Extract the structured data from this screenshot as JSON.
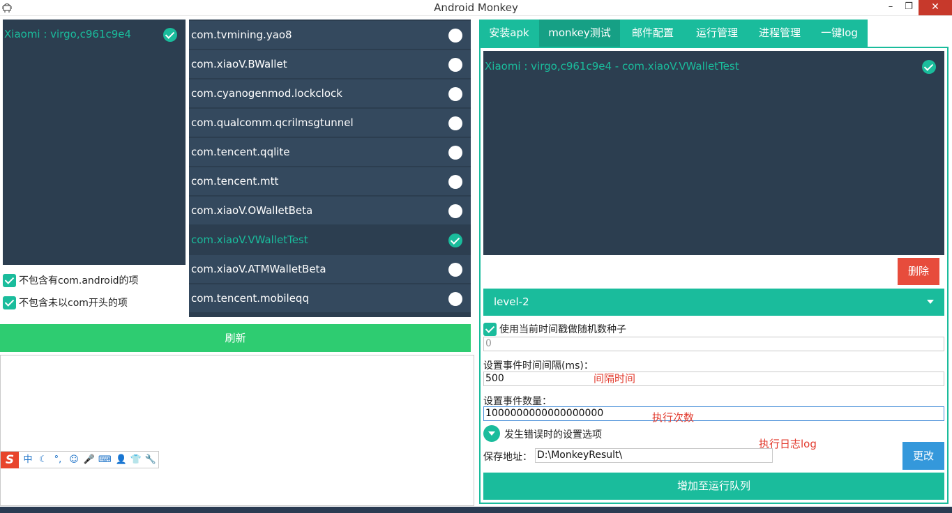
{
  "window": {
    "title": "Android Monkey",
    "minimize_glyph": "–",
    "maximize_glyph": "❐",
    "close_glyph": "✕"
  },
  "devices": {
    "items": [
      {
        "label": "Xiaomi : virgo,c961c9e4",
        "selected": true
      }
    ]
  },
  "filters": {
    "exclude_android": "不包含有com.android的项",
    "exclude_non_com": "不包含未以com开头的项"
  },
  "packages": {
    "items": [
      {
        "label": "com.tvmining.yao8",
        "selected": false
      },
      {
        "label": "com.xiaoV.BWallet",
        "selected": false
      },
      {
        "label": "com.cyanogenmod.lockclock",
        "selected": false
      },
      {
        "label": "com.qualcomm.qcrilmsgtunnel",
        "selected": false
      },
      {
        "label": "com.tencent.qqlite",
        "selected": false
      },
      {
        "label": "com.tencent.mtt",
        "selected": false
      },
      {
        "label": "com.xiaoV.OWalletBeta",
        "selected": false
      },
      {
        "label": "com.xiaoV.VWalletTest",
        "selected": true
      },
      {
        "label": "com.xiaoV.ATMWalletBeta",
        "selected": false
      },
      {
        "label": "com.tencent.mobileqq",
        "selected": false
      }
    ]
  },
  "refresh_label": "刷新",
  "ime_bar": {
    "logo": "S",
    "icons": [
      "中",
      "☾",
      "°,",
      "☺",
      "🎤",
      "⌨",
      "👤",
      "👕",
      "🔧"
    ]
  },
  "tabs": [
    {
      "label": "安装apk",
      "active": false
    },
    {
      "label": "monkey测试",
      "active": true
    },
    {
      "label": "邮件配置",
      "active": false
    },
    {
      "label": "运行管理",
      "active": false
    },
    {
      "label": "进程管理",
      "active": false
    },
    {
      "label": "一键log",
      "active": false
    }
  ],
  "queue": {
    "items": [
      {
        "label": "Xiaomi : virgo,c961c9e4 - com.xiaoV.VWalletTest",
        "selected": true
      }
    ]
  },
  "delete_label": "删除",
  "level": {
    "value": "level-2"
  },
  "seed": {
    "checkbox_label": "使用当前时间戳做随机数种子",
    "value": "0"
  },
  "interval": {
    "label": "设置事件时间间隔(ms)：",
    "value": "500",
    "annotation": "间隔时间"
  },
  "count": {
    "label": "设置事件数量：",
    "value": "1000000000000000000",
    "annotation": "执行次数"
  },
  "error_options_label": "发生错误时的设置选项",
  "log_annotation": "执行日志log",
  "save": {
    "label": "保存地址：",
    "value": "D:\\MonkeyResult\\"
  },
  "change_label": "更改",
  "add_queue_label": "增加至运行队列",
  "colors": {
    "teal": "#1abc9c",
    "dark_panel": "#2c3e50",
    "green": "#2ecc71",
    "red": "#e74c3c",
    "blue": "#3498db"
  }
}
